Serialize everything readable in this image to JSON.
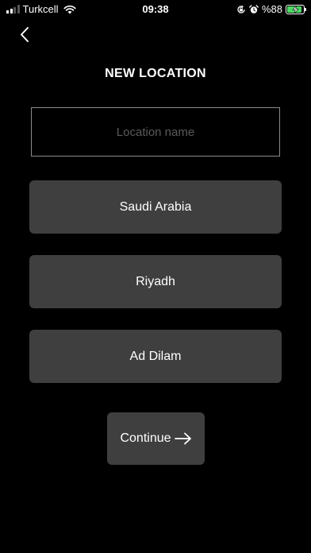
{
  "status_bar": {
    "carrier": "Turkcell",
    "time": "09:38",
    "battery_percent": "%88",
    "battery_level": 0.88,
    "battery_color": "#4cd964",
    "icons": [
      "signal-icon",
      "wifi-icon",
      "orientation-lock-icon",
      "alarm-icon",
      "battery-icon",
      "charging-bolt-icon"
    ]
  },
  "header": {
    "back_icon": "chevron-left-icon",
    "title": "NEW LOCATION"
  },
  "form": {
    "location_name_placeholder": "Location name",
    "location_name_value": "",
    "country": "Saudi Arabia",
    "city": "Riyadh",
    "district": "Ad Dilam"
  },
  "actions": {
    "continue_label": "Continue",
    "continue_icon": "arrow-right-icon"
  }
}
